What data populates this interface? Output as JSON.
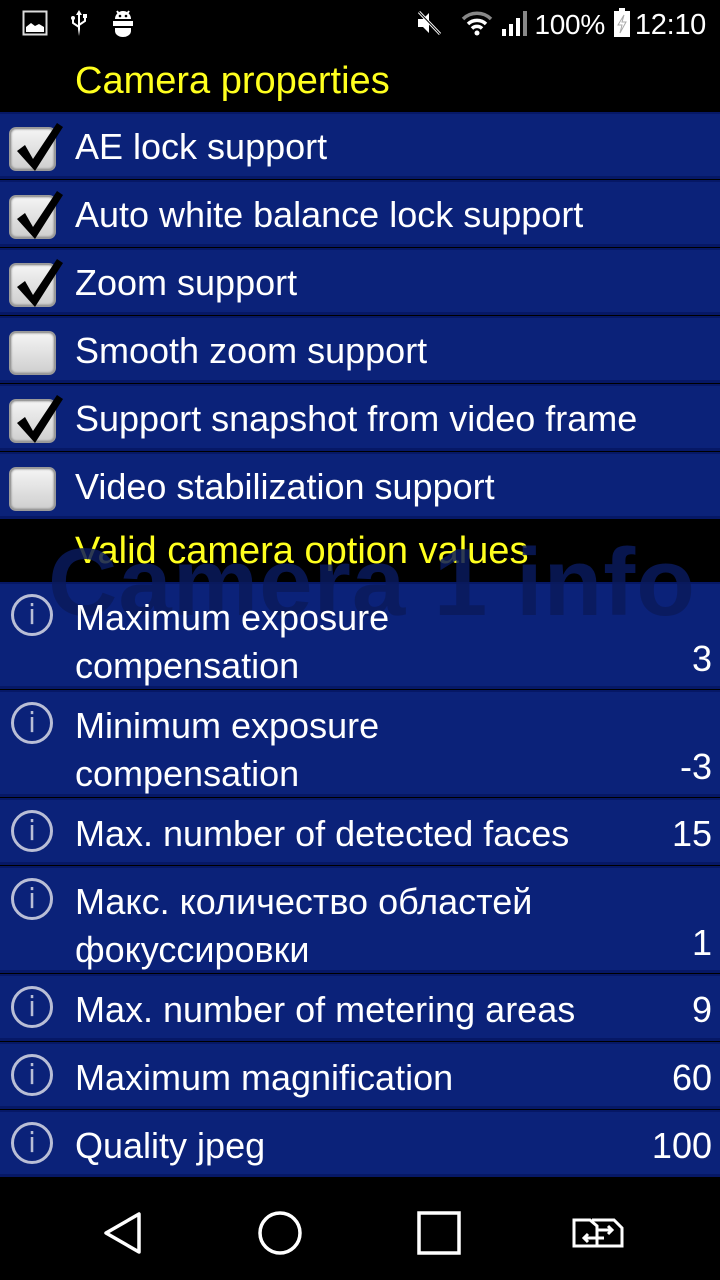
{
  "status_bar": {
    "left_icons": [
      "gallery-icon",
      "usb-icon",
      "android-debug-icon"
    ],
    "right_icons": [
      "mute-icon",
      "wifi-icon",
      "signal-icon",
      "battery-charging-icon"
    ],
    "battery_percent": "100%",
    "time": "12:10"
  },
  "sections": {
    "camera_properties": {
      "title": "Camera properties",
      "items": [
        {
          "label": "AE lock support",
          "checked": true
        },
        {
          "label": "Auto white balance lock support",
          "checked": true
        },
        {
          "label": "Zoom support",
          "checked": true
        },
        {
          "label": "Smooth zoom support",
          "checked": false
        },
        {
          "label": "Support snapshot from video frame",
          "checked": true
        },
        {
          "label": "Video stabilization support",
          "checked": false
        }
      ]
    },
    "valid_values": {
      "title": "Valid camera option values",
      "watermark": "Camera 1 info",
      "items": [
        {
          "label_line1": "Maximum exposure",
          "label_line2": "compensation",
          "value": "3"
        },
        {
          "label_line1": "Minimum exposure",
          "label_line2": "compensation",
          "value": "-3"
        },
        {
          "label_line1": "Max. number of detected faces",
          "label_line2": "",
          "value": "15"
        },
        {
          "label_line1": "Макс. количество областей",
          "label_line2": "фокуссировки",
          "value": "1"
        },
        {
          "label_line1": "Max. number of metering areas",
          "label_line2": "",
          "value": "9"
        },
        {
          "label_line1": "Maximum magnification",
          "label_line2": "",
          "value": "60"
        },
        {
          "label_line1": "Quality jpeg",
          "label_line2": "",
          "value": "100"
        }
      ]
    }
  },
  "nav_bar": {
    "buttons": [
      "back-icon",
      "home-icon",
      "recents-icon",
      "switch-sim-icon"
    ]
  },
  "colors": {
    "header_text": "#ffff1e",
    "row_bg": "#0b2279",
    "row_separator": "#061866"
  }
}
